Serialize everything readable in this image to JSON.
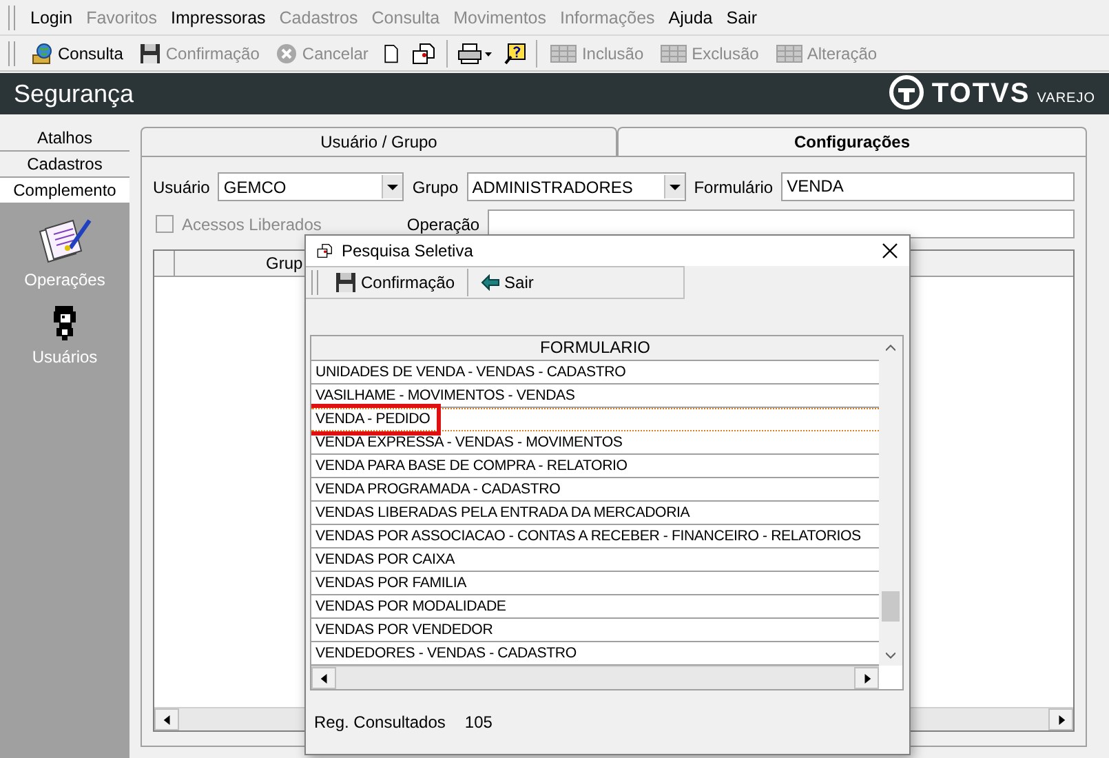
{
  "menu": [
    {
      "label": "Login",
      "disabled": false
    },
    {
      "label": "Favoritos",
      "disabled": true
    },
    {
      "label": "Impressoras",
      "disabled": false
    },
    {
      "label": "Cadastros",
      "disabled": true
    },
    {
      "label": "Consulta",
      "disabled": true
    },
    {
      "label": "Movimentos",
      "disabled": true
    },
    {
      "label": "Informações",
      "disabled": true
    },
    {
      "label": "Ajuda",
      "disabled": false
    },
    {
      "label": "Sair",
      "disabled": false
    }
  ],
  "toolbar": [
    {
      "kind": "button",
      "label": "Consulta",
      "disabled": false
    },
    {
      "kind": "button",
      "label": "Confirmação",
      "disabled": true
    },
    {
      "kind": "button",
      "label": "Cancelar",
      "disabled": true
    },
    {
      "kind": "icon",
      "disabled": false
    },
    {
      "kind": "icon",
      "disabled": false
    },
    {
      "kind": "sep"
    },
    {
      "kind": "icon",
      "disabled": false
    },
    {
      "kind": "icon",
      "disabled": false
    },
    {
      "kind": "sep"
    },
    {
      "kind": "button",
      "label": "Inclusão",
      "disabled": true
    },
    {
      "kind": "button",
      "label": "Exclusão",
      "disabled": true
    },
    {
      "kind": "button",
      "label": "Alteração",
      "disabled": true
    }
  ],
  "title": "Segurança",
  "logo": {
    "brand": "TOTVS",
    "sub": "VAREJO"
  },
  "sidebar": {
    "tabs": [
      {
        "label": "Atalhos",
        "selected": false
      },
      {
        "label": "Cadastros",
        "selected": false
      },
      {
        "label": "Complemento",
        "selected": true
      }
    ],
    "items": [
      {
        "label": "Operações"
      },
      {
        "label": "Usuários"
      }
    ]
  },
  "tabs": [
    {
      "label": "Usuário  / Grupo",
      "selected": false
    },
    {
      "label": "Configurações",
      "selected": true
    }
  ],
  "form": {
    "usuario_label": "Usuário",
    "usuario": "GEMCO",
    "grupo_label": "Grupo",
    "grupo": "ADMINISTRADORES",
    "formulario_label": "Formulário",
    "formulario": "VENDA",
    "acessos": {
      "label": "Acessos Liberados",
      "checked": false,
      "disabled": true
    },
    "operacao_label": "Operação"
  },
  "grid": {
    "column_1": "Grup"
  },
  "dialog": {
    "title": "Pesquisa Seletiva",
    "buttons": [
      {
        "label": "Confirmação"
      },
      {
        "label": "Sair"
      }
    ],
    "column": "FORMULARIO",
    "rows": [
      {
        "text": "UNIDADES DE VENDA - VENDAS - CADASTRO",
        "selected": false,
        "highlighted": false
      },
      {
        "text": "VASILHAME - MOVIMENTOS - VENDAS",
        "selected": false,
        "highlighted": false
      },
      {
        "text": "VENDA - PEDIDO",
        "selected": true,
        "highlighted": true
      },
      {
        "text": "VENDA EXPRESSA - VENDAS - MOVIMENTOS",
        "selected": false,
        "highlighted": false
      },
      {
        "text": "VENDA PARA BASE DE COMPRA - RELATORIO",
        "selected": false,
        "highlighted": false
      },
      {
        "text": "VENDA PROGRAMADA - CADASTRO",
        "selected": false,
        "highlighted": false
      },
      {
        "text": "VENDAS LIBERADAS PELA ENTRADA DA MERCADORIA",
        "selected": false,
        "highlighted": false
      },
      {
        "text": "VENDAS POR ASSOCIACAO - CONTAS A RECEBER - FINANCEIRO - RELATORIOS",
        "selected": false,
        "highlighted": false
      },
      {
        "text": "VENDAS POR CAIXA",
        "selected": false,
        "highlighted": false
      },
      {
        "text": "VENDAS POR FAMILIA",
        "selected": false,
        "highlighted": false
      },
      {
        "text": "VENDAS POR MODALIDADE",
        "selected": false,
        "highlighted": false
      },
      {
        "text": "VENDAS POR VENDEDOR",
        "selected": false,
        "highlighted": false
      },
      {
        "text": "VENDEDORES - VENDAS - CADASTRO",
        "selected": false,
        "highlighted": false
      }
    ],
    "status_label": "Reg. Consultados",
    "status_value": "105"
  }
}
